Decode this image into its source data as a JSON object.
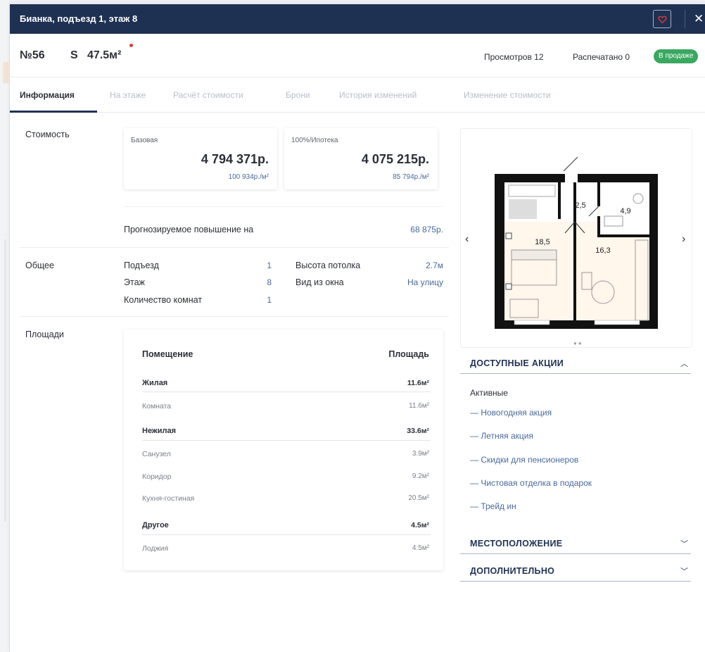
{
  "header": {
    "title": "Бианка, подъезд 1, этаж 8",
    "close_label": "✕"
  },
  "apartment": {
    "number": "№56",
    "area_prefix": "S",
    "area": "47.5м²",
    "views": "Просмотров 12",
    "printed": "Распечатано 0",
    "status": "В продаже",
    "status_color": "#3aa860"
  },
  "tabs": [
    {
      "label": "Информация",
      "active": true
    },
    {
      "label": "На этаже",
      "active": false
    },
    {
      "label": "Расчёт стоимости",
      "active": false
    },
    {
      "label": "Брони",
      "active": false
    },
    {
      "label": "История изменений",
      "active": false
    },
    {
      "label": "Изменение стоимости",
      "active": false
    }
  ],
  "cost": {
    "section_label": "Стоимость",
    "cards": [
      {
        "label": "Базовая",
        "value": "4 794 371р.",
        "per_m2": "100 934р./м²"
      },
      {
        "label": "100%/Ипотека",
        "value": "4 075 215р.",
        "per_m2": "85 794р./м²"
      }
    ],
    "forecast_label": "Прогнозируемое повышение на",
    "forecast_value": "68 875р."
  },
  "general": {
    "section_label": "Общее",
    "left": [
      {
        "key": "Подъезд",
        "value": "1"
      },
      {
        "key": "Этаж",
        "value": "8"
      },
      {
        "key": "Количество комнат",
        "value": "1"
      }
    ],
    "right": [
      {
        "key": "Высота потолка",
        "value": "2.7м"
      },
      {
        "key": "Вид из окна",
        "value": "На улицу"
      }
    ]
  },
  "areas": {
    "section_label": "Площади",
    "header_room": "Помещение",
    "header_area": "Площадь",
    "groups": [
      {
        "name": "Жилая",
        "total": "11.6м²",
        "rows": [
          {
            "name": "Комната",
            "value": "11.6м²"
          }
        ]
      },
      {
        "name": "Нежилая",
        "total": "33.6м²",
        "rows": [
          {
            "name": "Санузел",
            "value": "3.9м²"
          },
          {
            "name": "Коридор",
            "value": "9.2м²"
          },
          {
            "name": "Кухня-гостиная",
            "value": "20.5м²"
          }
        ]
      },
      {
        "name": "Другое",
        "total": "4.5м²",
        "rows": [
          {
            "name": "Лоджия",
            "value": "4.5м²"
          }
        ]
      }
    ]
  },
  "plan": {
    "room_labels": [
      "2,5",
      "4,9",
      "18,5",
      "16,3"
    ],
    "prev_icon": "chevron-left-icon",
    "next_icon": "chevron-right-icon"
  },
  "promos": {
    "title": "ДОСТУПНЫЕ АКЦИИ",
    "subtitle": "Активные",
    "items": [
      "— Новогодняя акция",
      "— Летняя акция",
      "— Скидки для пенсионеров",
      "— Чистовая отделка в подарок",
      "— Трейд ин"
    ]
  },
  "location": {
    "title": "МЕСТОПОЛОЖЕНИЕ"
  },
  "extra": {
    "title": "ДОПОЛНИТЕЛЬНО"
  },
  "colors": {
    "header_bg": "#1f3152",
    "link": "#4a6a9a",
    "accent_red": "#e03b3b"
  }
}
